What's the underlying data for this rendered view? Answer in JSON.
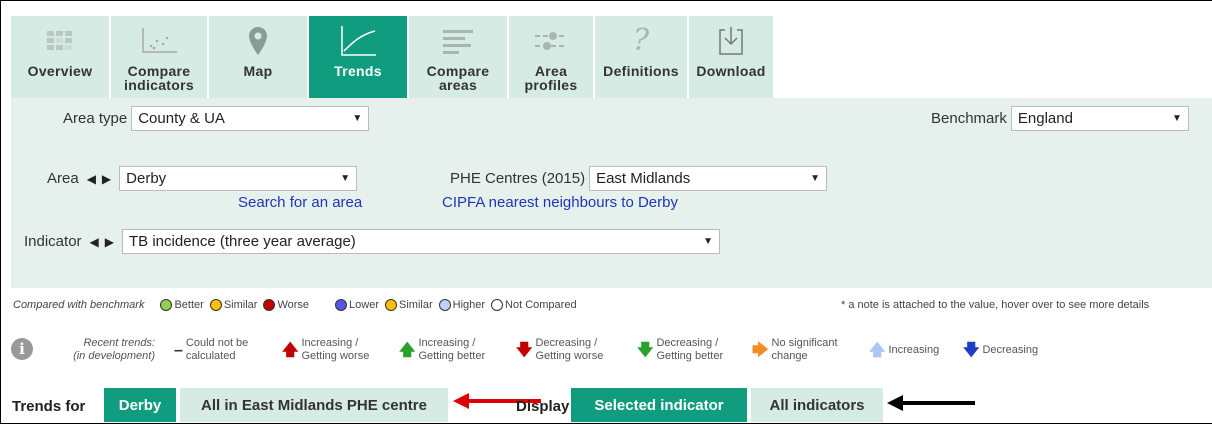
{
  "nav": {
    "tabs": [
      {
        "label_line1": "Overview",
        "label_line2": "",
        "icon": "overview-icon",
        "active": false
      },
      {
        "label_line1": "Compare",
        "label_line2": "indicators",
        "icon": "scatter-icon",
        "active": false
      },
      {
        "label_line1": "Map",
        "label_line2": "",
        "icon": "map-pin-icon",
        "active": false
      },
      {
        "label_line1": "Trends",
        "label_line2": "",
        "icon": "trend-line-icon",
        "active": true
      },
      {
        "label_line1": "Compare",
        "label_line2": "areas",
        "icon": "bars-icon",
        "active": false
      },
      {
        "label_line1": "Area",
        "label_line2": "profiles",
        "icon": "sliders-icon",
        "active": false
      },
      {
        "label_line1": "Definitions",
        "label_line2": "",
        "icon": "question-icon",
        "active": false
      },
      {
        "label_line1": "Download",
        "label_line2": "",
        "icon": "download-icon",
        "active": false
      }
    ]
  },
  "filters": {
    "area_type_label": "Area type",
    "area_type_value": "County & UA",
    "benchmark_label": "Benchmark",
    "benchmark_value": "England",
    "area_label": "Area",
    "area_value": "Derby",
    "search_link": "Search for an area",
    "phe_label": "PHE Centres (2015)",
    "phe_value": "East Midlands",
    "cipfa_link": "CIPFA nearest neighbours to Derby",
    "indicator_label": "Indicator",
    "indicator_value": "TB incidence (three year average)"
  },
  "legend": {
    "compared_label": "Compared with benchmark",
    "better": "Better",
    "similar": "Similar",
    "worse": "Worse",
    "lower": "Lower",
    "similar2": "Similar",
    "higher": "Higher",
    "not_compared": "Not Compared",
    "note": "* a note is attached to the value, hover over to see more details",
    "colors": {
      "better": "#92d050",
      "similar": "#ffc000",
      "worse": "#c00000",
      "lower": "#5555e6",
      "higher": "#bed2ff"
    }
  },
  "trends": {
    "recent_line1": "Recent trends:",
    "recent_line2": "(in development)",
    "items": [
      {
        "line1": "Could not be",
        "line2": "calculated"
      },
      {
        "line1": "Increasing /",
        "line2": "Getting worse"
      },
      {
        "line1": "Increasing /",
        "line2": "Getting better"
      },
      {
        "line1": "Decreasing /",
        "line2": "Getting worse"
      },
      {
        "line1": "Decreasing /",
        "line2": "Getting better"
      },
      {
        "line1": "No significant",
        "line2": "change"
      },
      {
        "line1": "Increasing",
        "line2": ""
      },
      {
        "line1": "Decreasing",
        "line2": ""
      }
    ]
  },
  "bottom": {
    "trends_for_label": "Trends for",
    "derby_btn": "Derby",
    "all_in_btn": "All in East Midlands PHE centre",
    "display_label": "Display",
    "selected_btn": "Selected indicator",
    "all_indicators_btn": "All indicators"
  }
}
